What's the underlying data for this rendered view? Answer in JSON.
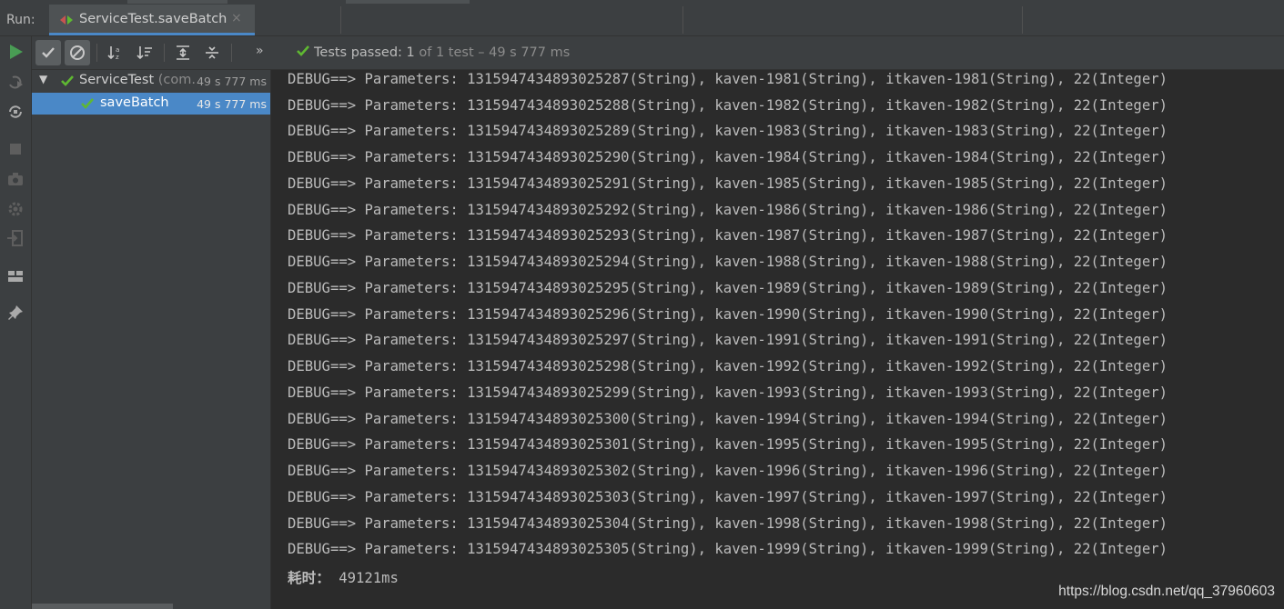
{
  "run_panel": {
    "label": "Run:",
    "tab_title": "ServiceTest.saveBatch",
    "tab_close": "×"
  },
  "toolbar": {
    "more": "»",
    "status_passed": "Tests passed: 1",
    "status_detail": "of 1 test – 49 s 777 ms"
  },
  "tree": {
    "root": {
      "name": "ServiceTest",
      "pkg": "(com.",
      "time": "49 s 777 ms"
    },
    "child": {
      "name": "saveBatch",
      "time": "49 s 777 ms"
    }
  },
  "console": {
    "lines": [
      "DEBUG==> Parameters: 1315947434893025287(String), kaven-1981(String), itkaven-1981(String), 22(Integer)",
      "DEBUG==> Parameters: 1315947434893025288(String), kaven-1982(String), itkaven-1982(String), 22(Integer)",
      "DEBUG==> Parameters: 1315947434893025289(String), kaven-1983(String), itkaven-1983(String), 22(Integer)",
      "DEBUG==> Parameters: 1315947434893025290(String), kaven-1984(String), itkaven-1984(String), 22(Integer)",
      "DEBUG==> Parameters: 1315947434893025291(String), kaven-1985(String), itkaven-1985(String), 22(Integer)",
      "DEBUG==> Parameters: 1315947434893025292(String), kaven-1986(String), itkaven-1986(String), 22(Integer)",
      "DEBUG==> Parameters: 1315947434893025293(String), kaven-1987(String), itkaven-1987(String), 22(Integer)",
      "DEBUG==> Parameters: 1315947434893025294(String), kaven-1988(String), itkaven-1988(String), 22(Integer)",
      "DEBUG==> Parameters: 1315947434893025295(String), kaven-1989(String), itkaven-1989(String), 22(Integer)",
      "DEBUG==> Parameters: 1315947434893025296(String), kaven-1990(String), itkaven-1990(String), 22(Integer)",
      "DEBUG==> Parameters: 1315947434893025297(String), kaven-1991(String), itkaven-1991(String), 22(Integer)",
      "DEBUG==> Parameters: 1315947434893025298(String), kaven-1992(String), itkaven-1992(String), 22(Integer)",
      "DEBUG==> Parameters: 1315947434893025299(String), kaven-1993(String), itkaven-1993(String), 22(Integer)",
      "DEBUG==> Parameters: 1315947434893025300(String), kaven-1994(String), itkaven-1994(String), 22(Integer)",
      "DEBUG==> Parameters: 1315947434893025301(String), kaven-1995(String), itkaven-1995(String), 22(Integer)",
      "DEBUG==> Parameters: 1315947434893025302(String), kaven-1996(String), itkaven-1996(String), 22(Integer)",
      "DEBUG==> Parameters: 1315947434893025303(String), kaven-1997(String), itkaven-1997(String), 22(Integer)",
      "DEBUG==> Parameters: 1315947434893025304(String), kaven-1998(String), itkaven-1998(String), 22(Integer)",
      "DEBUG==> Parameters: 1315947434893025305(String), kaven-1999(String), itkaven-1999(String), 22(Integer)"
    ],
    "timing_label": "耗时：",
    "timing_value": "49121ms"
  },
  "watermark": "https://blog.csdn.net/qq_37960603",
  "colors": {
    "background": "#2b2b2b",
    "panel": "#3c3f41",
    "selection": "#4a88c7",
    "pass_green": "#5fb832",
    "run_green": "#499c54"
  },
  "icons": [
    "run-icon",
    "rerun-failed-icon",
    "toggle-autotest-icon",
    "stop-icon",
    "camera-icon",
    "settings-icon",
    "exit-icon",
    "layout-icon",
    "pin-icon",
    "show-passed-icon",
    "show-ignored-icon",
    "sort-alpha-icon",
    "sort-duration-icon",
    "expand-all-icon",
    "collapse-all-icon",
    "check-icon"
  ]
}
